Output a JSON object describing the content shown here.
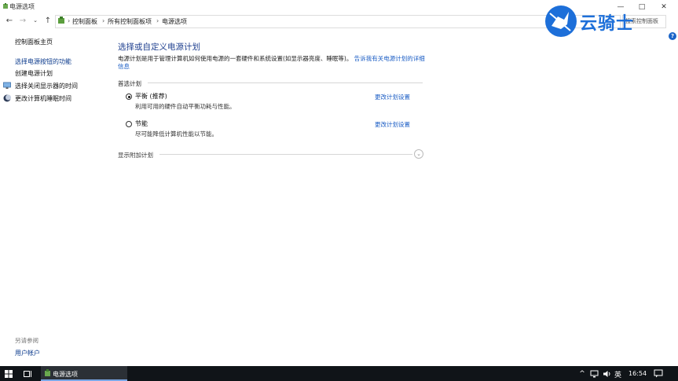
{
  "window": {
    "title": "电源选项",
    "controls": [
      "—",
      "□",
      "✕"
    ]
  },
  "address": {
    "breadcrumbs": [
      "控制面板",
      "所有控制面板项",
      "电源选项"
    ],
    "search_placeholder": "搜索控制面板"
  },
  "sidebar": {
    "items": [
      {
        "label": "控制面板主页",
        "icon": null
      },
      {
        "label": "选择电源按钮的功能",
        "icon": null
      },
      {
        "label": "创建电源计划",
        "icon": null
      },
      {
        "label": "选择关闭显示器的时间",
        "icon": "monitor-icon"
      },
      {
        "label": "更改计算机睡眠时间",
        "icon": "moon-icon"
      }
    ],
    "see_also_title": "另请参阅",
    "see_also_links": [
      "用户帐户"
    ]
  },
  "main": {
    "title": "选择或自定义电源计划",
    "intro_text": "电源计划是用于管理计算机如何使用电源的一套硬件和系统设置(如显示器亮度、睡眠等)。",
    "intro_link": "告诉我有关电源计划的详细信息",
    "section_header": "首选计划",
    "plans": [
      {
        "name": "平衡 (推荐)",
        "description": "利用可用的硬件自动平衡功耗与性能。",
        "checked": true,
        "change_link": "更改计划设置"
      },
      {
        "name": "节能",
        "description": "尽可能降低计算机性能以节能。",
        "checked": false,
        "change_link": "更改计划设置"
      }
    ],
    "extra_plans_label": "显示附加计划"
  },
  "watermark": {
    "text": "云骑士"
  },
  "taskbar": {
    "app_label": "电源选项",
    "language": "英",
    "clock": "16:54"
  },
  "colors": {
    "link": "#1a5cc4",
    "title": "#1e3f8f",
    "taskbar": "#101418",
    "watermark": "#1d6fd9"
  }
}
